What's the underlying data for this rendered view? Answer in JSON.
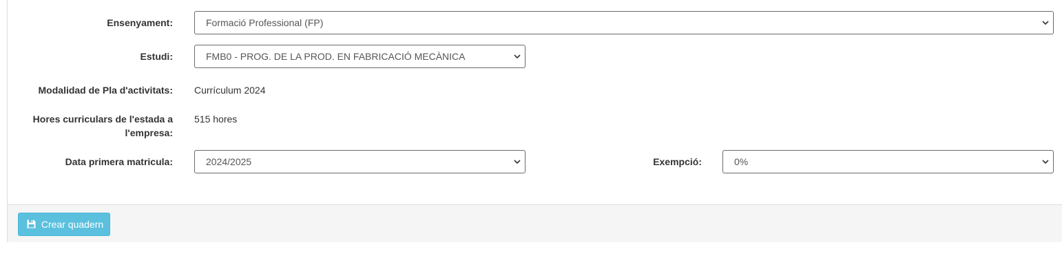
{
  "form": {
    "ensenyament": {
      "label": "Ensenyament:",
      "selected": "Formació Professional (FP)"
    },
    "estudi": {
      "label": "Estudi:",
      "selected": "FMB0 - PROG. DE LA PROD. EN FABRICACIÓ MECÀNICA"
    },
    "modalitat": {
      "label": "Modalidad de Pla d'activitats:",
      "value": "Currículum 2024"
    },
    "hores": {
      "label_line1": "Hores curriculars de l'estada a",
      "label_line2": "l'empresa:",
      "value": "515 hores"
    },
    "data_primera_matricula": {
      "label": "Data primera matricula:",
      "selected": "2024/2025"
    },
    "exempcio": {
      "label": "Exempció:",
      "selected": "0%"
    }
  },
  "footer": {
    "create_button_label": "Crear quadern",
    "create_button_icon": "floppy-disk-icon"
  },
  "colors": {
    "button_bg": "#5bc0de",
    "footer_bg": "#f5f5f5"
  }
}
